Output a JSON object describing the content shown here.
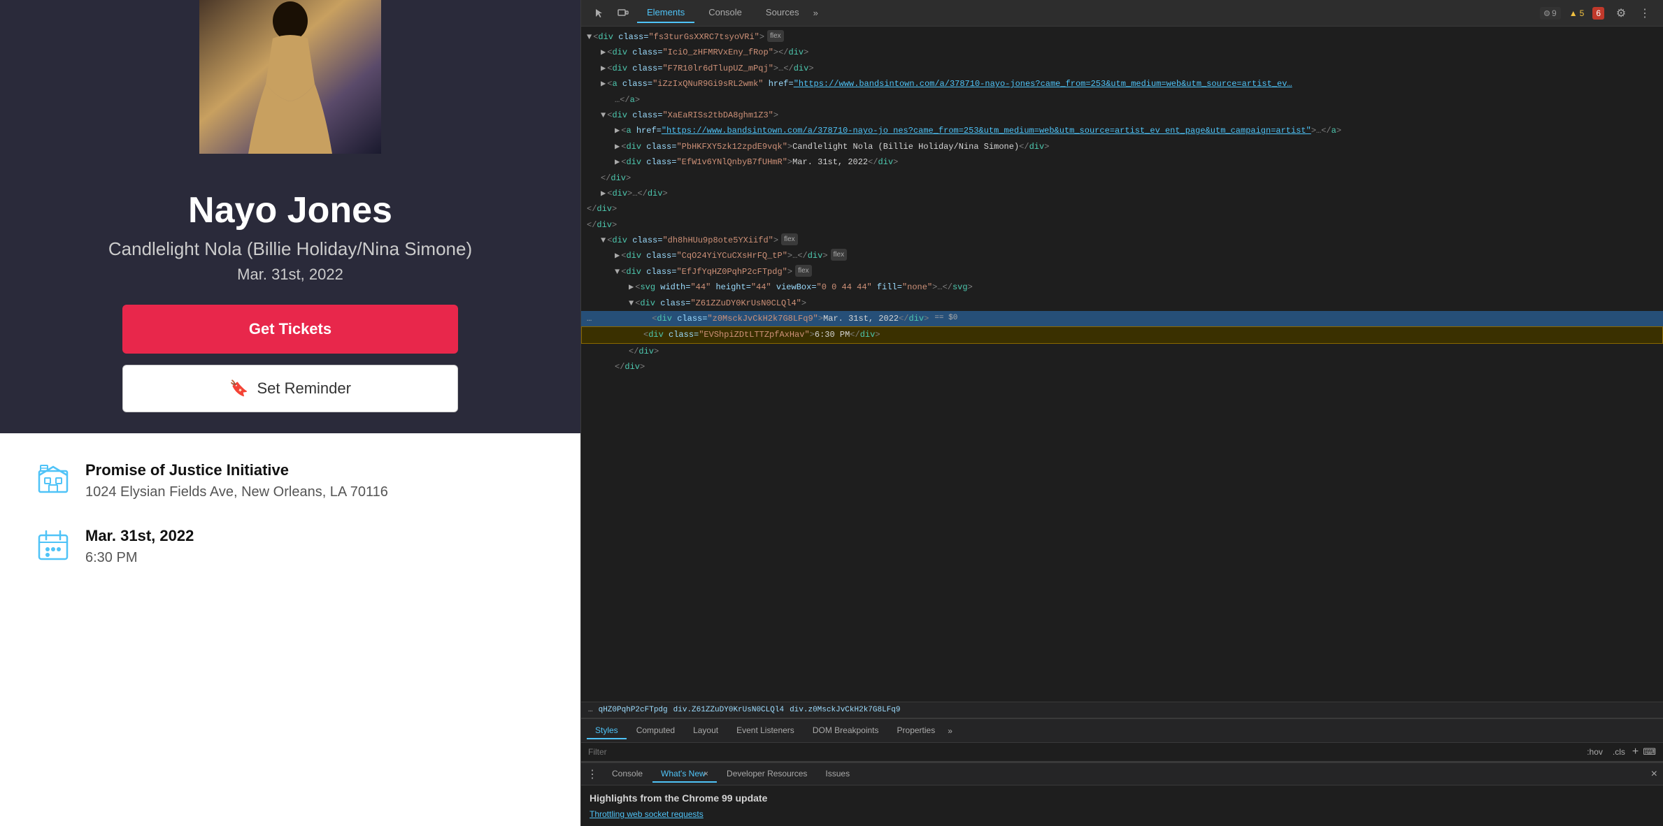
{
  "leftPanel": {
    "artist": {
      "name": "Nayo Jones",
      "eventTitle": "Candlelight Nola (Billie Holiday/Nina Simone)",
      "eventDate": "Mar. 31st, 2022",
      "getTicketsLabel": "Get Tickets",
      "setReminderLabel": "Set Reminder"
    },
    "details": {
      "venue": {
        "name": "Promise of Justice Initiative",
        "address": "1024 Elysian Fields Ave, New Orleans, LA 70116"
      },
      "dateTime": {
        "date": "Mar. 31st, 2022",
        "time": "6:30 PM"
      }
    }
  },
  "devtools": {
    "tabs": [
      "Elements",
      "Console",
      "Sources"
    ],
    "activeTab": "Elements",
    "moreTabsLabel": "»",
    "badges": {
      "errorCount": "9",
      "warnCount": "5",
      "extCount": "6"
    },
    "domTree": {
      "lines": [
        {
          "indent": 2,
          "html": "<div class=\"fs3turGsXXRC7tsyoVRi\">",
          "badge": "flex"
        },
        {
          "indent": 3,
          "html": "<div class=\"IciO_zHFMRVxEny_fRop\"></div>"
        },
        {
          "indent": 3,
          "html": "<div class=\"F7R10lr6dTlupUZ_mPqj\">…</div>"
        },
        {
          "indent": 3,
          "html": "<a class=\"iZzIxQNuR9Gi9sRL2wmk\" href=\"https://www.bandsintown.com/a/378710-nayo-jones?came_from=253&utm_medium=web&utm_source=artist_event_page&utm_campaign=artist\">"
        },
        {
          "indent": 4,
          "html": "…</a>"
        },
        {
          "indent": 3,
          "html": "<div class=\"XaEaRISs2tbDA8ghm1Z3\">"
        },
        {
          "indent": 4,
          "html": "<a href=\"https://www.bandsintown.com/a/378710-nayo-jones?came_from=253&utm_medium=web&utm_source=artist_event_page&utm_campaign=artist\">…</a>"
        },
        {
          "indent": 4,
          "html": "<div class=\"PbHKFXY5zk12zpdE9vqk\">Candlelight Nola (Billie Holiday/Nina Simone)</div>"
        },
        {
          "indent": 4,
          "html": "<div class=\"EfW1v6YNlQnbyB7fUHmR\">Mar. 31st, 2022</div>"
        },
        {
          "indent": 3,
          "html": "</div>"
        },
        {
          "indent": 3,
          "html": "<div>…</div>"
        },
        {
          "indent": 2,
          "html": "</div>"
        },
        {
          "indent": 1,
          "html": "</div>"
        },
        {
          "indent": 2,
          "html": "<div class=\"dh8hHUu9p8ote5YXiifd\">",
          "badge": "flex"
        },
        {
          "indent": 3,
          "html": "<div class=\"CqO24YiYCuCXsHrFQ_tP\">…</div>",
          "badge": "flex"
        },
        {
          "indent": 3,
          "html": "<div class=\"EfJfYqHZ0PqhP2cFTpdg\">",
          "badge": "flex",
          "expanded": true
        },
        {
          "indent": 4,
          "html": "<svg width=\"44\" height=\"44\" viewBox=\"0 0 44 44\" fill=\"none\">…</svg>"
        },
        {
          "indent": 4,
          "html": "<div class=\"Z61ZZuDY0KrUsN0CLQl4\">"
        },
        {
          "indent": 5,
          "html": "<div class=\"z0MsckJvCkH2k7G8LFq9\">Mar. 31st, 2022</div>",
          "selected": true,
          "eqS0": true
        },
        {
          "indent": 5,
          "html": "<div class=\"EVShpiZDtLTTZpfAxHav\">6:30 PM</div>",
          "highlighted": true
        },
        {
          "indent": 4,
          "html": "</div>"
        },
        {
          "indent": 3,
          "html": "</div>"
        }
      ]
    },
    "breadcrumb": {
      "items": [
        "qHZ0PqhP2cFTpdg",
        "div.Z61ZZuDY0KrUsN0CLQl4",
        "div.z0MsckJvCkH2k7G8LFq9"
      ]
    },
    "stylesTabs": [
      "Styles",
      "Computed",
      "Layout",
      "Event Listeners",
      "DOM Breakpoints",
      "Properties"
    ],
    "activeStylesTab": "Styles",
    "moreStylesTabs": "»",
    "filter": {
      "placeholder": "Filter",
      "hovLabel": ":hov",
      "clsLabel": ".cls",
      "plusLabel": "+",
      "bracketLabel": "⌨"
    },
    "consoleTabs": [
      "Console",
      "What's New",
      "Developer Resources",
      "Issues"
    ],
    "activeConsoleTab": "What's New",
    "whatsNew": {
      "title": "Highlights from the Chrome 99 update",
      "throttleLink": "Throttling web socket requests"
    }
  }
}
